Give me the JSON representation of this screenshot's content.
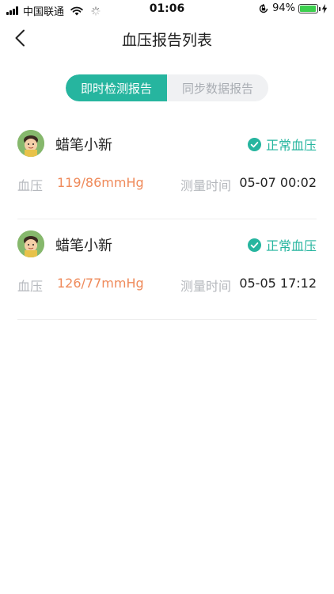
{
  "status_bar": {
    "carrier": "中国联通",
    "time": "01:06",
    "battery_percent_text": "94%",
    "battery_level": 0.94,
    "battery_color": "#3ccf4e"
  },
  "nav": {
    "back_icon": "chevron-left-icon",
    "title": "血压报告列表"
  },
  "tabs": [
    {
      "label": "即时检测报告",
      "active": true
    },
    {
      "label": "同步数据报告",
      "active": false
    }
  ],
  "colors": {
    "accent": "#26b59f",
    "bp_value": "#ef8a5a",
    "muted": "#b5b8bd"
  },
  "reports": [
    {
      "name": "蜡笔小新",
      "status": "正常血压",
      "bp_label": "血压",
      "bp_value": "119/86mmHg",
      "time_label": "测量时间",
      "time_value": "05-07 00:02"
    },
    {
      "name": "蜡笔小新",
      "status": "正常血压",
      "bp_label": "血压",
      "bp_value": "126/77mmHg",
      "time_label": "测量时间",
      "time_value": "05-05 17:12"
    }
  ]
}
